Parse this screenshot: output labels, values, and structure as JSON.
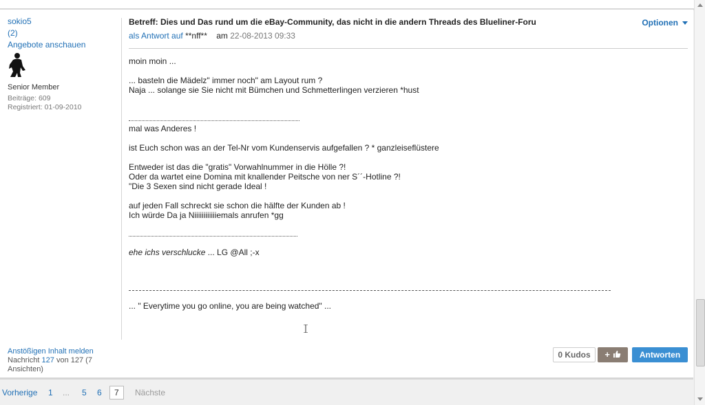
{
  "author": {
    "name": "sokio5",
    "rank": "(2)",
    "offers_link": "Angebote anschauen",
    "role": "Senior Member",
    "posts": "Beiträge: 609",
    "registered": "Registriert: 01-09-2010"
  },
  "post": {
    "subject": "Betreff: Dies und Das rund um die eBay-Community, das nicht in die andern Threads des Blueliner-Foru",
    "reply_prefix": "als Antwort auf",
    "reply_user": "**nff**",
    "date_prefix": "am",
    "date": "22-08-2013 09:33",
    "options_label": "Optionen",
    "lines": {
      "l1": "moin moin ...",
      "l2": "... basteln die Mädelz\" immer noch\" am Layout rum ?",
      "l3": "Naja ... solange sie Sie nicht mit Bümchen und Schmetterlingen verzieren *hust",
      "l4": "mal was Anderes !",
      "l5": "ist Euch schon was an der Tel-Nr vom Kundenservis aufgefallen ? * ganzleiseflüstere",
      "l6": "Entweder ist das die \"gratis\" Vorwahlnummer in die Hölle ?!",
      "l7": "Oder da wartet eine Domina mit knallender Peitsche von ner S´´-Hotline ?!",
      "l8": "\"Die 3 Sexen sind nicht gerade Ideal !",
      "l9": "auf jeden Fall schreckt sie schon die hälfte der Kunden ab !",
      "l10": "Ich würde Da ja Niiiiiiiiiiiiemals anrufen  *gg",
      "l11_italic": "ehe ichs verschlucke",
      "l11_rest": " ... LG @All ;-x",
      "signature": "... \" Everytime you go online, you are being watched\" ..."
    }
  },
  "footer": {
    "report": "Anstößigen Inhalt melden",
    "msg_prefix": "Nachricht",
    "msg_num": "127",
    "msg_mid": "von 127 (7 Ansichten)",
    "kudos": "0 Kudos",
    "plus": "+",
    "reply": "Antworten"
  },
  "pager": {
    "prev": "Vorherige",
    "p1": "1",
    "ellipsis": "...",
    "p5": "5",
    "p6": "6",
    "p7": "7",
    "next": "Nächste"
  }
}
